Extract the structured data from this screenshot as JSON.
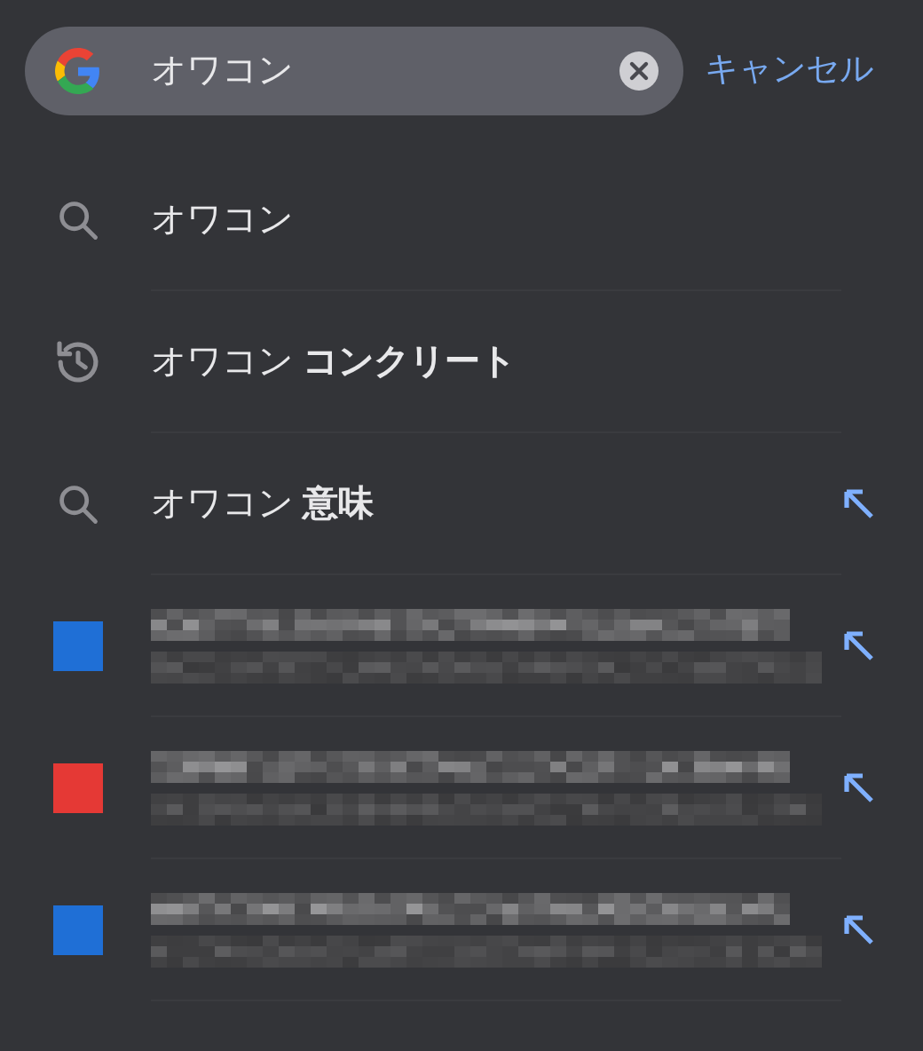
{
  "search": {
    "value": "オワコン",
    "cancel": "キャンセル"
  },
  "suggestions": [
    {
      "kind": "search",
      "text": "オワコン",
      "fill_arrow": false
    },
    {
      "kind": "history",
      "text": "オワコン **コンクリート**",
      "fill_arrow": false
    },
    {
      "kind": "search",
      "text": "オワコン **意味**",
      "fill_arrow": true
    },
    {
      "kind": "redacted",
      "color": "#1f6fd6",
      "fill_arrow": true
    },
    {
      "kind": "redacted",
      "color": "#e53935",
      "fill_arrow": true
    },
    {
      "kind": "redacted",
      "color": "#1f6fd6",
      "fill_arrow": true
    }
  ]
}
